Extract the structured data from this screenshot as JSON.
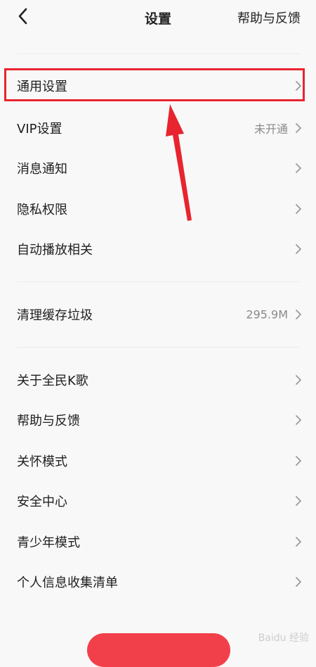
{
  "header": {
    "title": "设置",
    "help_link": "帮助与反馈"
  },
  "groups": [
    {
      "items": [
        {
          "name": "settings-item-general",
          "label": "通用设置",
          "value": "",
          "highlighted": true
        },
        {
          "name": "settings-item-vip",
          "label": "VIP设置",
          "value": "未开通"
        },
        {
          "name": "settings-item-notifications",
          "label": "消息通知",
          "value": ""
        },
        {
          "name": "settings-item-privacy",
          "label": "隐私权限",
          "value": ""
        },
        {
          "name": "settings-item-autoplay",
          "label": "自动播放相关",
          "value": ""
        }
      ]
    },
    {
      "items": [
        {
          "name": "settings-item-clear-cache",
          "label": "清理缓存垃圾",
          "value": "295.9M"
        }
      ]
    },
    {
      "items": [
        {
          "name": "settings-item-about",
          "label": "关于全民K歌",
          "value": ""
        },
        {
          "name": "settings-item-help",
          "label": "帮助与反馈",
          "value": ""
        },
        {
          "name": "settings-item-care-mode",
          "label": "关怀模式",
          "value": ""
        },
        {
          "name": "settings-item-security-center",
          "label": "安全中心",
          "value": ""
        },
        {
          "name": "settings-item-teen-mode",
          "label": "青少年模式",
          "value": ""
        },
        {
          "name": "settings-item-personal-info",
          "label": "个人信息收集清单",
          "value": ""
        }
      ]
    }
  ],
  "colors": {
    "background": "#f8f8f8",
    "annotation": "#e8242f",
    "chevron": "#9a9a9a",
    "bottom_button": "#f2404b"
  },
  "watermark": "Baidu 经验"
}
